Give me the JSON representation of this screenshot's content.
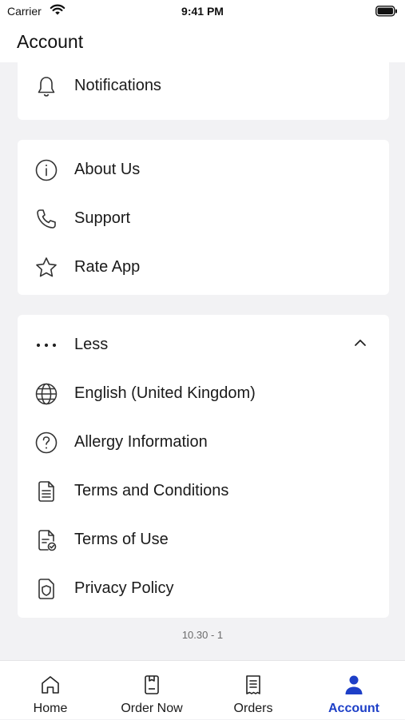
{
  "status_bar": {
    "carrier": "Carrier",
    "time": "9:41 PM"
  },
  "header": {
    "title": "Account"
  },
  "sections": {
    "notifications": {
      "label": "Notifications",
      "icon": "bell-icon"
    },
    "info": [
      {
        "label": "About Us",
        "icon": "info-icon"
      },
      {
        "label": "Support",
        "icon": "phone-icon"
      },
      {
        "label": "Rate App",
        "icon": "star-icon"
      }
    ],
    "more": {
      "toggle_label": "Less",
      "toggle_icon": "more-dots-icon",
      "expanded": true,
      "items": [
        {
          "label": "English (United Kingdom)",
          "icon": "globe-icon"
        },
        {
          "label": "Allergy Information",
          "icon": "question-icon"
        },
        {
          "label": "Terms and Conditions",
          "icon": "document-list-icon"
        },
        {
          "label": "Terms of Use",
          "icon": "document-check-icon"
        },
        {
          "label": "Privacy Policy",
          "icon": "shield-document-icon"
        }
      ]
    }
  },
  "version": "10.30 - 1",
  "tabbar": {
    "active": "Account",
    "accent_color": "#1d3fc7",
    "tabs": [
      {
        "label": "Home",
        "icon": "home-icon"
      },
      {
        "label": "Order Now",
        "icon": "order-icon"
      },
      {
        "label": "Orders",
        "icon": "receipt-icon"
      },
      {
        "label": "Account",
        "icon": "person-icon"
      }
    ]
  }
}
